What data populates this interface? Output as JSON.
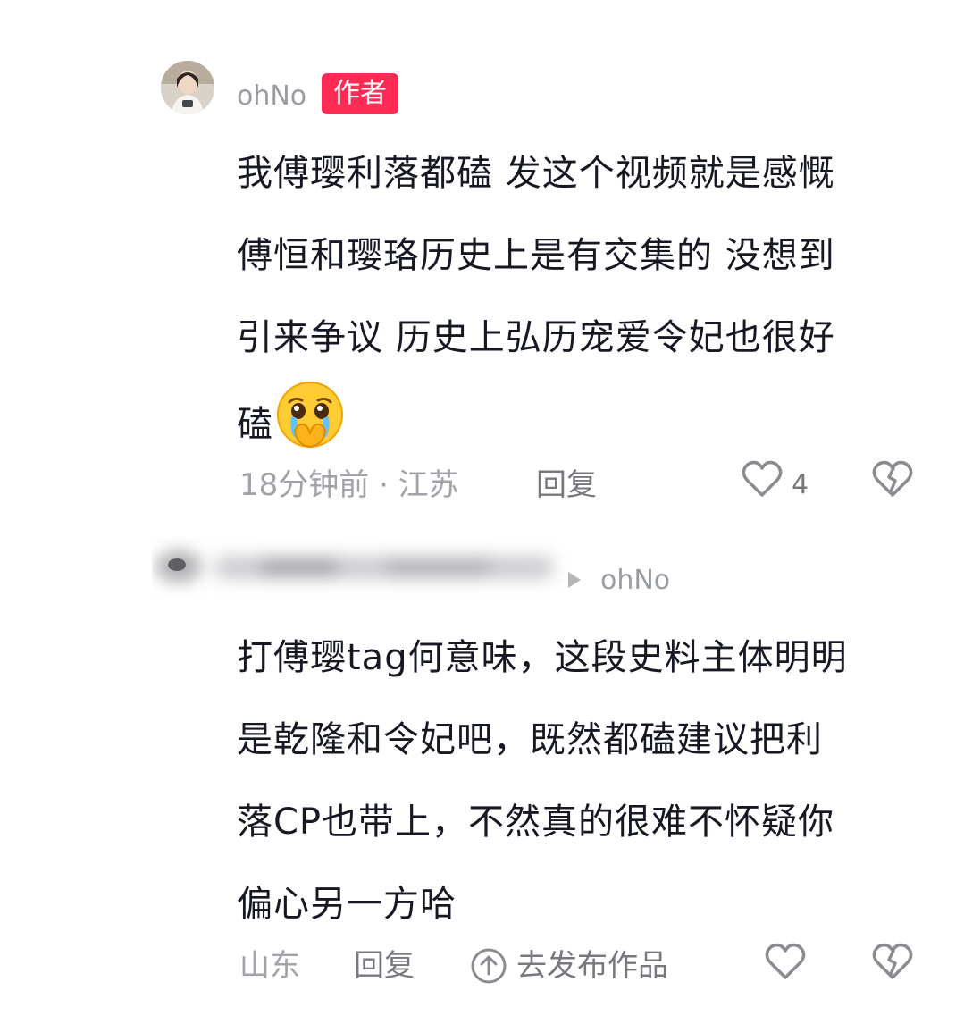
{
  "comment1": {
    "username": "ohNo",
    "badge": "作者",
    "lines": [
      "我傅璎利落都磕 发这个视频就是感慨",
      "傅恒和璎珞历史上是有交集的 没想到",
      "引来争议 历史上弘历宠爱令妃也很好",
      "磕"
    ],
    "emoji": "crying-face-emoji",
    "meta": "18分钟前 · 江苏",
    "reply_label": "回复",
    "like_count": "4"
  },
  "comment2": {
    "reply_to": "ohNo",
    "lines": [
      "打傅璎tag何意味，这段史料主体明明",
      "是乾隆和令妃吧，既然都磕建议把利",
      "落CP也带上，不然真的很难不怀疑你",
      "偏心另一方哈"
    ],
    "meta": "山东",
    "reply_label": "回复",
    "publish_label": "去发布作品"
  },
  "icons": {
    "like": "heart-outline-icon",
    "dislike": "broken-heart-icon",
    "publish": "up-arrow-circle-icon"
  },
  "colors": {
    "badge": "#fe2c55",
    "text": "#161823",
    "meta": "#a1a3a8"
  }
}
